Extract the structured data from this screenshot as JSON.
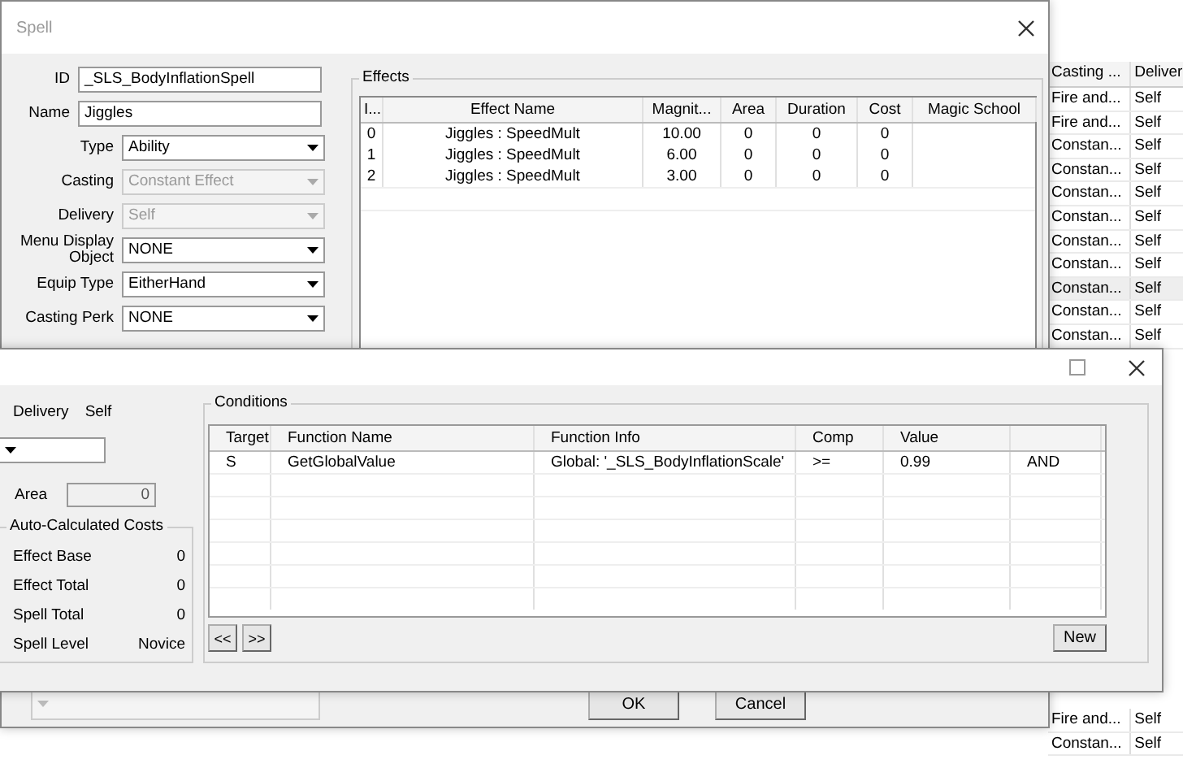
{
  "background_list": {
    "columns": [
      "Casting ...",
      "Deliver"
    ],
    "rows_top": [
      [
        "Fire and...",
        "Self"
      ],
      [
        "Fire and...",
        "Self"
      ],
      [
        "Constan...",
        "Self"
      ],
      [
        "Constan...",
        "Self"
      ],
      [
        "Constan...",
        "Self"
      ],
      [
        "Constan...",
        "Self"
      ],
      [
        "Constan...",
        "Self"
      ],
      [
        "Constan...",
        "Self"
      ],
      [
        "Constan...",
        "Self"
      ],
      [
        "Constan...",
        "Self"
      ],
      [
        "Constan...",
        "Self"
      ]
    ],
    "rows_bottom": [
      [
        "Fire and...",
        "Self"
      ],
      [
        "Constan...",
        "Self"
      ]
    ]
  },
  "spell_window": {
    "title": "Spell",
    "fields": [
      {
        "label": "ID",
        "kind": "text",
        "value": "_SLS_BodyInflationSpell"
      },
      {
        "label": "Name",
        "kind": "text",
        "value": "Jiggles"
      },
      {
        "label": "Type",
        "kind": "dropdown",
        "value": "Ability",
        "disabled": false
      },
      {
        "label": "Casting",
        "kind": "dropdown",
        "value": "Constant Effect",
        "disabled": true
      },
      {
        "label": "Delivery",
        "kind": "dropdown",
        "value": "Self",
        "disabled": true
      },
      {
        "label": "Menu Display Object",
        "kind": "dropdown",
        "value": "NONE",
        "disabled": false
      },
      {
        "label": "Equip Type",
        "kind": "dropdown",
        "value": "EitherHand",
        "disabled": false
      },
      {
        "label": "Casting Perk",
        "kind": "dropdown",
        "value": "NONE",
        "disabled": false
      }
    ],
    "effects": {
      "title": "Effects",
      "columns": [
        "I...",
        "Effect Name",
        "Magnit...",
        "Area",
        "Duration",
        "Cost",
        "Magic School"
      ],
      "rows": [
        [
          "0",
          "Jiggles : SpeedMult",
          "10.00",
          "0",
          "0",
          "0"
        ],
        [
          "1",
          "Jiggles : SpeedMult",
          "6.00",
          "0",
          "0",
          "0"
        ],
        [
          "2",
          "Jiggles : SpeedMult",
          "3.00",
          "0",
          "0",
          "0"
        ]
      ]
    },
    "buttons": [
      "OK",
      "Cancel"
    ]
  },
  "conditions_window": {
    "delivery_label": "Delivery",
    "delivery_value": "Self",
    "area_label": "Area",
    "area_value": "0",
    "costs": {
      "title": "Auto-Calculated Costs",
      "rows": [
        {
          "label": "Effect Base",
          "value": "0"
        },
        {
          "label": "Effect Total",
          "value": "0"
        },
        {
          "label": "Spell Total",
          "value": "0"
        },
        {
          "label": "Spell Level",
          "value": "Novice"
        }
      ]
    },
    "conditions": {
      "title": "Conditions",
      "columns": [
        "Target",
        "Function Name",
        "Function Info",
        "Comp",
        "Value"
      ],
      "rows": [
        [
          "S",
          "GetGlobalValue",
          "Global: '_SLS_BodyInflationScale'",
          ">=",
          "0.99",
          "AND"
        ]
      ]
    },
    "nav_buttons": [
      "<<",
      ">>"
    ],
    "new_button": "New"
  }
}
